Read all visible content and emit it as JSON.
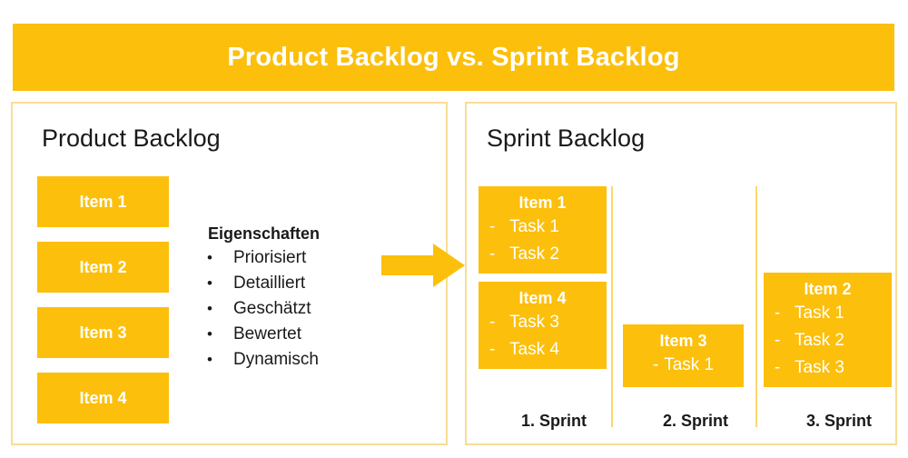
{
  "title": "Product Backlog vs. Sprint Backlog",
  "colors": {
    "accent": "#FCBF0B",
    "panel_border": "#F8DD92",
    "divider": "#FBD96B",
    "text": "#1a1a1a",
    "on_accent": "#FFFFFF"
  },
  "product_panel": {
    "heading": "Product Backlog",
    "items": [
      {
        "label": "Item 1"
      },
      {
        "label": "Item 2"
      },
      {
        "label": "Item 3"
      },
      {
        "label": "Item 4"
      }
    ],
    "properties": {
      "title": "Eigenschaften",
      "bullet": "•",
      "entries": [
        "Priorisiert",
        "Detailliert",
        "Geschätzt",
        "Bewertet",
        "Dynamisch"
      ]
    }
  },
  "arrow": {
    "icon": "arrow-right-icon",
    "direction": "right"
  },
  "sprint_panel": {
    "heading": "Sprint Backlog",
    "columns": [
      {
        "label": "1. Sprint",
        "cards": [
          {
            "title": "Item 1",
            "dash": "-",
            "tasks": [
              "Task 1",
              "Task 2"
            ]
          },
          {
            "title": "Item 4",
            "dash": "-",
            "tasks": [
              "Task 3",
              "Task 4"
            ]
          }
        ]
      },
      {
        "label": "2. Sprint",
        "cards": [
          {
            "title": "Item 3",
            "dash": "-",
            "tasks": [
              "Task 1"
            ]
          }
        ]
      },
      {
        "label": "3. Sprint",
        "cards": [
          {
            "title": "Item 2",
            "dash": "-",
            "tasks": [
              "Task 1",
              "Task 2",
              "Task 3"
            ]
          }
        ]
      }
    ]
  }
}
